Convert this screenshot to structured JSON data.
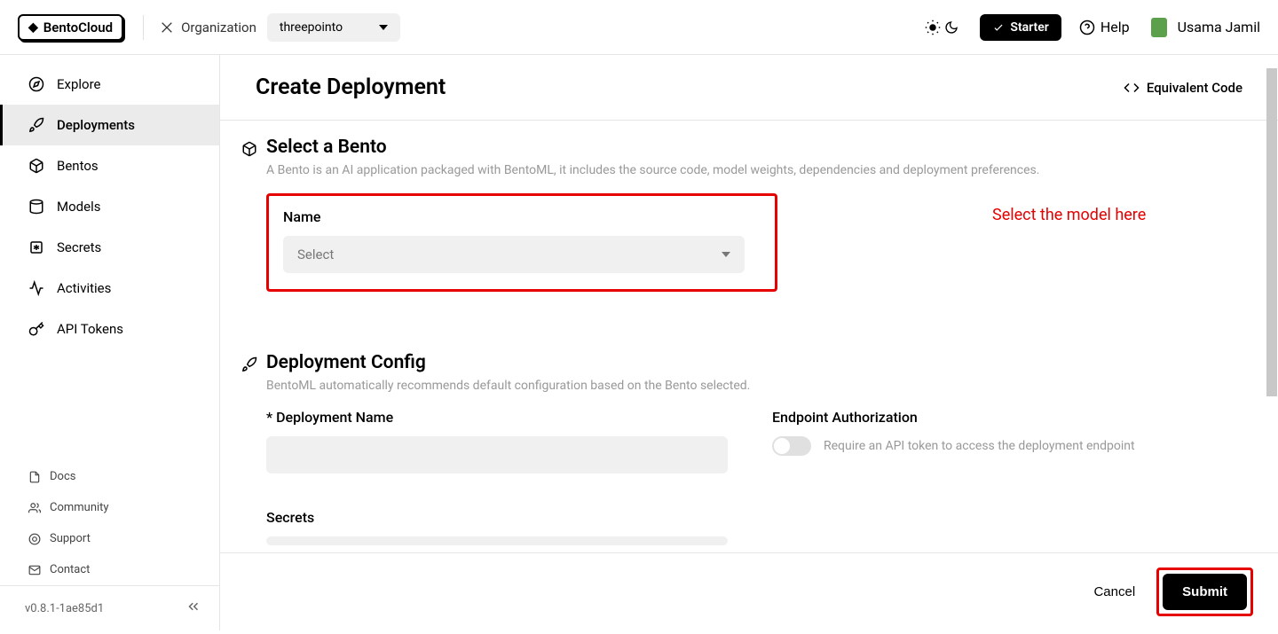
{
  "brand": {
    "name": "BentoCloud"
  },
  "header": {
    "org_label": "Organization",
    "org_value": "threepointo",
    "starter": "Starter",
    "help": "Help",
    "user": "Usama Jamil"
  },
  "sidebar": {
    "items": [
      {
        "label": "Explore"
      },
      {
        "label": "Deployments"
      },
      {
        "label": "Bentos"
      },
      {
        "label": "Models"
      },
      {
        "label": "Secrets"
      },
      {
        "label": "Activities"
      },
      {
        "label": "API Tokens"
      }
    ],
    "footer": [
      {
        "label": "Docs"
      },
      {
        "label": "Community"
      },
      {
        "label": "Support"
      },
      {
        "label": "Contact"
      }
    ],
    "version": "v0.8.1-1ae85d1"
  },
  "page": {
    "title": "Create Deployment",
    "equiv_code": "Equivalent Code"
  },
  "section_bento": {
    "title": "Select a Bento",
    "desc": "A Bento is an AI application packaged with BentoML, it includes the source code, model weights, dependencies and deployment preferences.",
    "name_label": "Name",
    "select_placeholder": "Select"
  },
  "annotation": "Select the model here",
  "section_config": {
    "title": "Deployment Config",
    "desc": "BentoML automatically recommends default configuration based on the Bento selected.",
    "deployment_name_label": "* Deployment Name",
    "endpoint_auth_label": "Endpoint Authorization",
    "endpoint_auth_desc": "Require an API token to access the deployment endpoint",
    "secrets_label": "Secrets"
  },
  "footer": {
    "cancel": "Cancel",
    "submit": "Submit"
  }
}
